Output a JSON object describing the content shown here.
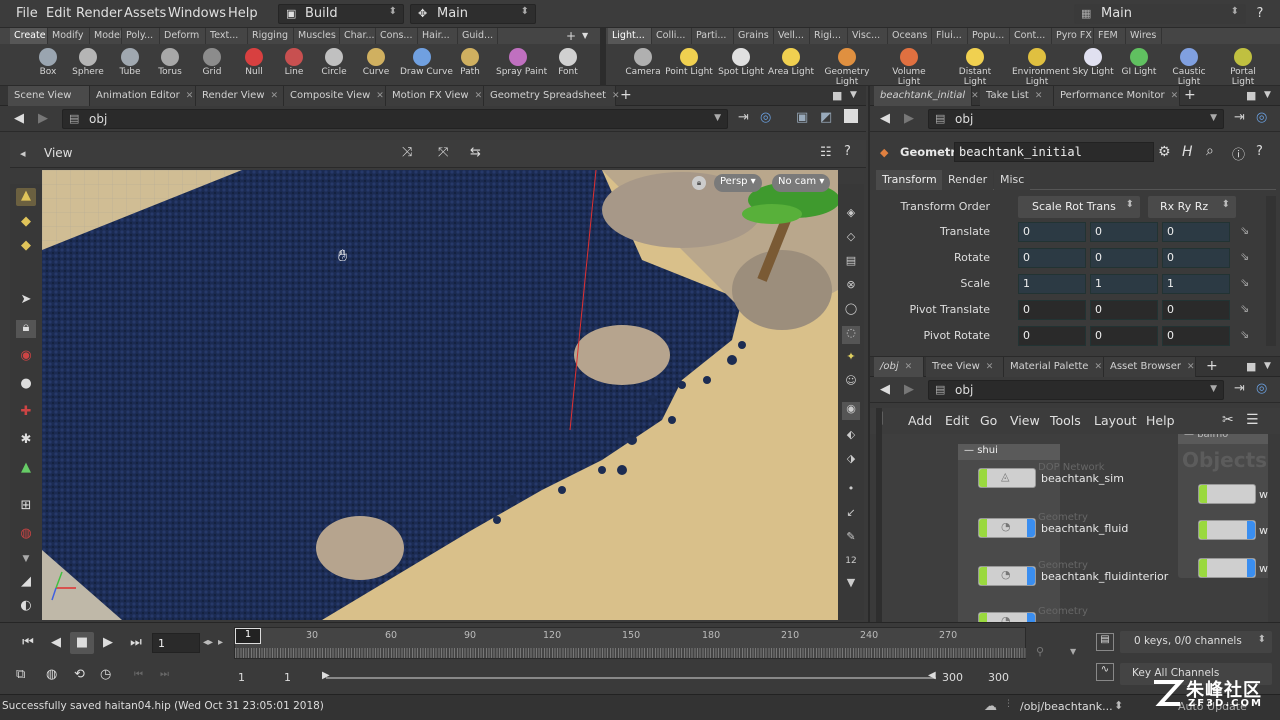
{
  "menubar": {
    "items": [
      "File",
      "Edit",
      "Render",
      "Assets",
      "Windows",
      "Help"
    ],
    "desktop_label": "Build",
    "context_label": "Main",
    "right_desktop": "Main"
  },
  "shelf_tabs_left": [
    "Create",
    "Modify",
    "Model",
    "Poly...",
    "Deform",
    "Text...",
    "Rigging",
    "Muscles",
    "Char...",
    "Cons...",
    "Hair...",
    "Guid..."
  ],
  "shelf_tabs_right": [
    "Light...",
    "Colli...",
    "Parti...",
    "Grains",
    "Vell...",
    "Rigi...",
    "Visc...",
    "Oceans",
    "Flui...",
    "Popu...",
    "Cont...",
    "Pyro FX",
    "FEM",
    "Wires"
  ],
  "shelf_tools_left": [
    {
      "label": "Box",
      "color": "#9aa5b0"
    },
    {
      "label": "Sphere",
      "color": "#b5b5b5"
    },
    {
      "label": "Tube",
      "color": "#a0a8b0"
    },
    {
      "label": "Torus",
      "color": "#a8a8a8"
    },
    {
      "label": "Grid",
      "color": "#8c8c8c"
    },
    {
      "label": "Null",
      "color": "#d84040"
    },
    {
      "label": "Line",
      "color": "#c85050"
    },
    {
      "label": "Circle",
      "color": "#c0c0c0"
    },
    {
      "label": "Curve",
      "color": "#d0b060"
    },
    {
      "label": "Draw Curve",
      "color": "#70a0e0"
    },
    {
      "label": "Path",
      "color": "#d0b060"
    },
    {
      "label": "Spray Paint",
      "color": "#c070c0"
    },
    {
      "label": "Font",
      "color": "#d0d0d0"
    }
  ],
  "shelf_tools_right": [
    {
      "label": "Camera",
      "color": "#b0b0b0"
    },
    {
      "label": "Point Light",
      "color": "#f0d050"
    },
    {
      "label": "Spot Light",
      "color": "#e0e0e0"
    },
    {
      "label": "Area Light",
      "color": "#f0d050"
    },
    {
      "label": "Geometry Light",
      "color": "#e09040"
    },
    {
      "label": "Volume Light",
      "color": "#e07040"
    },
    {
      "label": "Distant Light",
      "color": "#f0d050"
    },
    {
      "label": "Environment Light",
      "color": "#e0c040"
    },
    {
      "label": "Sky Light",
      "color": "#e0e0f0"
    },
    {
      "label": "GI Light",
      "color": "#60c060"
    },
    {
      "label": "Caustic Light",
      "color": "#80a0e0"
    },
    {
      "label": "Portal Light",
      "color": "#c0c040"
    }
  ],
  "left_pane": {
    "tabs": [
      "Scene View",
      "Animation Editor",
      "Render View",
      "Composite View",
      "Motion FX View",
      "Geometry Spreadsheet"
    ],
    "path": "obj",
    "view_label": "View",
    "persp": "Persp",
    "cam": "No cam"
  },
  "params_pane": {
    "tabs": [
      "beachtank_initial",
      "Take List",
      "Performance Monitor"
    ],
    "path": "obj",
    "node_type": "Geometry",
    "node_name": "beachtank_initial",
    "subtabs": [
      "Transform",
      "Render",
      "Misc"
    ],
    "transform_order_label": "Transform Order",
    "transform_order": "Scale Rot Trans",
    "rot_order": "Rx Ry Rz",
    "rows": [
      {
        "label": "Translate",
        "values": [
          "0",
          "0",
          "0"
        ]
      },
      {
        "label": "Rotate",
        "values": [
          "0",
          "0",
          "0"
        ]
      },
      {
        "label": "Scale",
        "values": [
          "1",
          "1",
          "1"
        ]
      },
      {
        "label": "Pivot Translate",
        "values": [
          "0",
          "0",
          "0"
        ]
      },
      {
        "label": "Pivot Rotate",
        "values": [
          "0",
          "0",
          "0"
        ]
      }
    ]
  },
  "network_pane": {
    "tabs": [
      "/obj",
      "Tree View",
      "Material Palette",
      "Asset Browser"
    ],
    "path": "obj",
    "menu": [
      "Add",
      "Edit",
      "Go",
      "View",
      "Tools",
      "Layout",
      "Help"
    ],
    "box_shui": "shui",
    "box_baimo": "baimo",
    "objects_watermark": "Objects",
    "nodes": [
      {
        "type": "DOP Network",
        "name": "beachtank_sim"
      },
      {
        "type": "Geometry",
        "name": "beachtank_fluid"
      },
      {
        "type": "Geometry",
        "name": "beachtank_fluidinterior"
      },
      {
        "type": "Geometry",
        "name": ""
      }
    ],
    "right_nodes": [
      "whi",
      "whi",
      "whi"
    ]
  },
  "timeline": {
    "current_frame": "1",
    "ticks": [
      "30",
      "60",
      "90",
      "120",
      "150",
      "180",
      "210",
      "240",
      "270"
    ],
    "frame_marker": "1",
    "range_start": "1",
    "range_start2": "1",
    "range_end": "300",
    "range_end2": "300",
    "keys_info": "0 keys, 0/0 channels",
    "key_all": "Key All Channels",
    "auto_update": "Auto Update"
  },
  "status": {
    "message": "Successfully saved haitan04.hip (Wed Oct 31 23:05:01 2018)",
    "path": "/obj/beachtank..."
  },
  "watermark": "ZF3D.COM"
}
